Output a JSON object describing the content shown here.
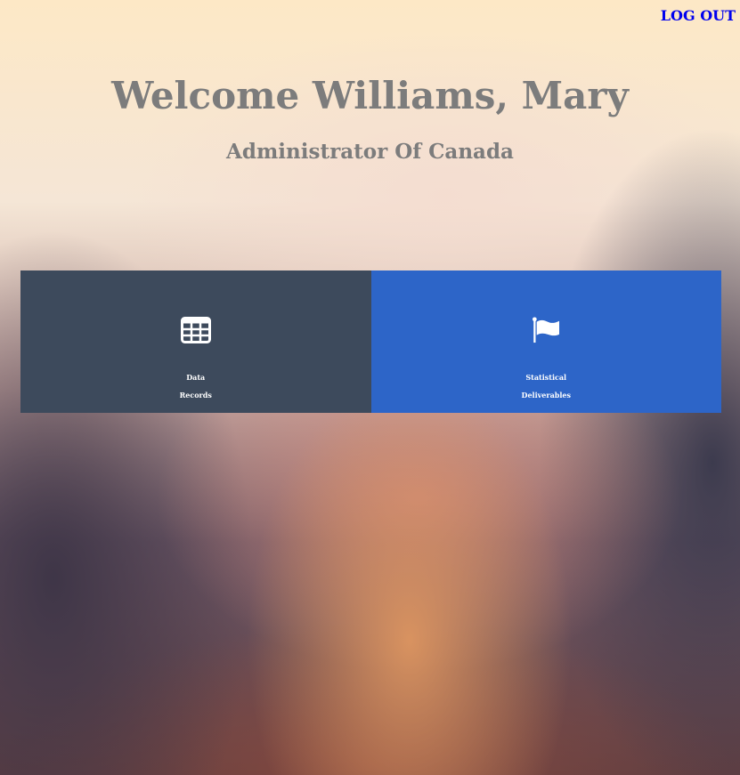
{
  "header": {
    "logout_label": "LOG OUT",
    "welcome_text": "Welcome Williams, Mary",
    "role_text": "Administrator Of Canada"
  },
  "tiles": [
    {
      "icon": "table-icon",
      "color": "#3d4a5c",
      "line1": "Data",
      "line2": "Records"
    },
    {
      "icon": "flag-icon",
      "color": "#2d65c8",
      "line1": "Statistical",
      "line2": "Deliverables"
    }
  ],
  "colors": {
    "link": "#0000ee",
    "heading": "#7c7c7c"
  }
}
